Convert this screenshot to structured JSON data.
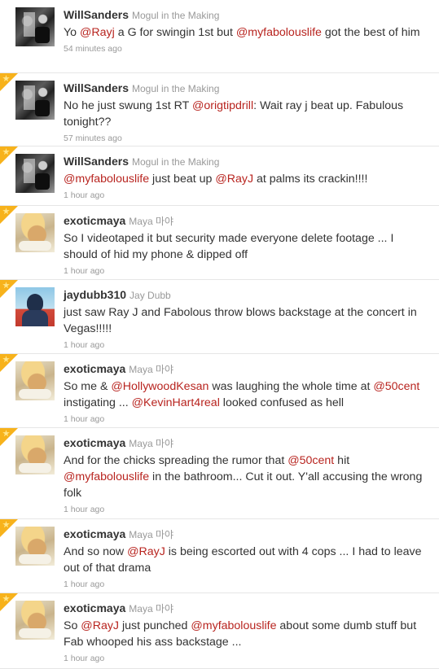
{
  "colors": {
    "mention": "#b8241f",
    "text": "#333333",
    "meta": "#999999",
    "favorite_star": "#f7b21b"
  },
  "tweets": [
    {
      "username": "WillSanders",
      "fullname": "Mogul in the Making",
      "favorited": false,
      "avatar_icon": "willsanders-avatar",
      "segments": [
        {
          "t": "Yo "
        },
        {
          "t": "@Rayj",
          "m": true
        },
        {
          "t": " a G for swingin 1st but "
        },
        {
          "t": "@myfabolouslife",
          "m": true
        },
        {
          "t": " got the best of him"
        }
      ],
      "time": "54 minutes ago"
    },
    {
      "username": "WillSanders",
      "fullname": "Mogul in the Making",
      "favorited": true,
      "avatar_icon": "willsanders-avatar",
      "segments": [
        {
          "t": "No he just swung 1st RT "
        },
        {
          "t": "@origtipdrill",
          "m": true
        },
        {
          "t": ": Wait ray j beat up. Fabulous tonight??"
        }
      ],
      "time": "57 minutes ago"
    },
    {
      "username": "WillSanders",
      "fullname": "Mogul in the Making",
      "favorited": true,
      "avatar_icon": "willsanders-avatar",
      "segments": [
        {
          "t": "@myfabolouslife",
          "m": true
        },
        {
          "t": " just beat up "
        },
        {
          "t": "@RayJ",
          "m": true
        },
        {
          "t": " at palms its crackin!!!!"
        }
      ],
      "time": "1 hour ago"
    },
    {
      "username": "exoticmaya",
      "fullname": "Maya 마야",
      "favorited": true,
      "avatar_icon": "exoticmaya-avatar",
      "segments": [
        {
          "t": "So I videotaped it but security made everyone delete footage ... I should of hid my phone & dipped off"
        }
      ],
      "time": "1 hour ago"
    },
    {
      "username": "jaydubb310",
      "fullname": "Jay Dubb",
      "favorited": true,
      "avatar_icon": "jaydubb310-avatar",
      "segments": [
        {
          "t": "just saw Ray J and Fabolous throw blows backstage at the concert in Vegas!!!!!"
        }
      ],
      "time": "1 hour ago"
    },
    {
      "username": "exoticmaya",
      "fullname": "Maya 마야",
      "favorited": true,
      "avatar_icon": "exoticmaya-avatar",
      "segments": [
        {
          "t": "So me & "
        },
        {
          "t": "@HollywoodKesan",
          "m": true
        },
        {
          "t": " was laughing the whole time at "
        },
        {
          "t": "@50cent",
          "m": true
        },
        {
          "t": " instigating ... "
        },
        {
          "t": "@KevinHart4real",
          "m": true
        },
        {
          "t": " looked confused as hell"
        }
      ],
      "time": "1 hour ago"
    },
    {
      "username": "exoticmaya",
      "fullname": "Maya 마야",
      "favorited": true,
      "avatar_icon": "exoticmaya-avatar",
      "segments": [
        {
          "t": "And for the chicks spreading the rumor that "
        },
        {
          "t": "@50cent",
          "m": true
        },
        {
          "t": " hit "
        },
        {
          "t": "@myfabolouslife",
          "m": true
        },
        {
          "t": " in the bathroom... Cut it out. Y'all accusing the wrong folk"
        }
      ],
      "time": "1 hour ago"
    },
    {
      "username": "exoticmaya",
      "fullname": "Maya 마야",
      "favorited": true,
      "avatar_icon": "exoticmaya-avatar",
      "segments": [
        {
          "t": "And so now "
        },
        {
          "t": "@RayJ",
          "m": true
        },
        {
          "t": " is being escorted out with 4 cops ... I had to leave out of that drama"
        }
      ],
      "time": "1 hour ago"
    },
    {
      "username": "exoticmaya",
      "fullname": "Maya 마야",
      "favorited": true,
      "avatar_icon": "exoticmaya-avatar",
      "segments": [
        {
          "t": "So "
        },
        {
          "t": "@RayJ",
          "m": true
        },
        {
          "t": " just punched "
        },
        {
          "t": "@myfabolouslife",
          "m": true
        },
        {
          "t": " about some dumb stuff but Fab whooped his ass backstage ..."
        }
      ],
      "time": "1 hour ago"
    }
  ]
}
